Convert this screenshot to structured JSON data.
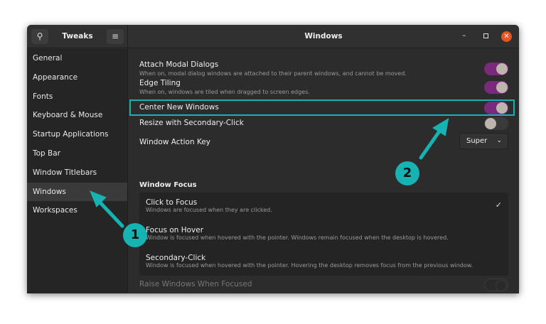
{
  "app_title": "Tweaks",
  "page_title": "Windows",
  "sidebar": {
    "items": [
      {
        "label": "General"
      },
      {
        "label": "Appearance"
      },
      {
        "label": "Fonts"
      },
      {
        "label": "Keyboard & Mouse"
      },
      {
        "label": "Startup Applications"
      },
      {
        "label": "Top Bar"
      },
      {
        "label": "Window Titlebars"
      },
      {
        "label": "Windows"
      },
      {
        "label": "Workspaces"
      }
    ],
    "selected": "Windows"
  },
  "settings": [
    {
      "title": "Attach Modal Dialogs",
      "desc": "When on, modal dialog windows are attached to their parent windows, and cannot be moved.",
      "on": true
    },
    {
      "title": "Edge Tiling",
      "desc": "When on, windows are tiled when dragged to screen edges.",
      "on": true
    },
    {
      "title": "Center New Windows",
      "on": true
    },
    {
      "title": "Resize with Secondary-Click",
      "on": false
    }
  ],
  "action_key": {
    "label": "Window Action Key",
    "value": "Super"
  },
  "focus": {
    "heading": "Window Focus",
    "items": [
      {
        "title": "Click to Focus",
        "desc": "Windows are focused when they are clicked.",
        "selected": true
      },
      {
        "title": "Focus on Hover",
        "desc": "Window is focused when hovered with the pointer. Windows remain focused when the desktop is hovered."
      },
      {
        "title": "Secondary-Click",
        "desc": "Window is focused when hovered with the pointer. Hovering the desktop removes focus from the previous window."
      }
    ]
  },
  "raise": {
    "title": "Raise Windows When Focused",
    "on": false,
    "disabled": true
  },
  "annotations": [
    "1",
    "2"
  ],
  "colors": {
    "accent": "#7a2a7a",
    "annotation": "#17b3b3",
    "close": "#e95420"
  }
}
